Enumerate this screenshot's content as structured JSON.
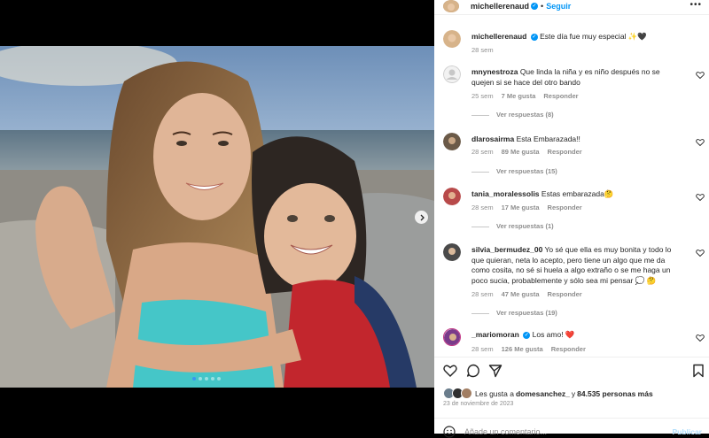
{
  "post": {
    "username": "michellerenaud",
    "follow_label": "Seguir",
    "more_label": "•••",
    "caption": "Este día fue muy especial ✨🖤",
    "caption_time": "28 sem"
  },
  "comments": [
    {
      "user": "mnynestroza",
      "text": "Que linda la niña y es niño después no se quejen si se hace del otro bando",
      "time": "25 sem",
      "likes": "7 Me gusta",
      "reply": "Responder",
      "view_replies": "Ver respuestas (8)",
      "avatar_color": "#d9d9d9"
    },
    {
      "user": "dlarosairma",
      "text": "Esta Embarazada!!",
      "time": "28 sem",
      "likes": "89 Me gusta",
      "reply": "Responder",
      "view_replies": "Ver respuestas (15)",
      "avatar_color": "#6b5a48"
    },
    {
      "user": "tania_moralessolis",
      "text": "Estas embarazada🤔",
      "time": "28 sem",
      "likes": "17 Me gusta",
      "reply": "Responder",
      "view_replies": "Ver respuestas (1)",
      "avatar_color": "#b84a4a"
    },
    {
      "user": "silvia_bermudez_00",
      "text": "Yo sé que ella es muy bonita y todo lo que quieran, neta lo acepto, pero tiene un algo que me da como cosita, no sé si huela a algo extraño o se me haga un poco sucia, probablemente y sólo sea mi pensar 💭 🤔",
      "time": "28 sem",
      "likes": "47 Me gusta",
      "reply": "Responder",
      "view_replies": "Ver respuestas (19)",
      "avatar_color": "#4a4a4a"
    },
    {
      "user": "_mariomoran",
      "text": "Los amo! ❤️",
      "time": "28 sem",
      "likes": "126 Me gusta",
      "reply": "Responder",
      "avatar_color": "#7a3a8a"
    }
  ],
  "likes": {
    "prefix": "Les gusta a ",
    "user": "domesanchez_",
    "suffix": " y ",
    "count": "84.535 personas más"
  },
  "date": "23 de noviembre de 2023",
  "add_comment_placeholder": "Añade un comentario...",
  "publish_label": "Publicar",
  "carousel": {
    "count": 5,
    "active": 0
  },
  "colors": {
    "accent": "#0095f6",
    "text": "#262626",
    "muted": "#8e8e8e",
    "like_red": "#ed4956"
  }
}
